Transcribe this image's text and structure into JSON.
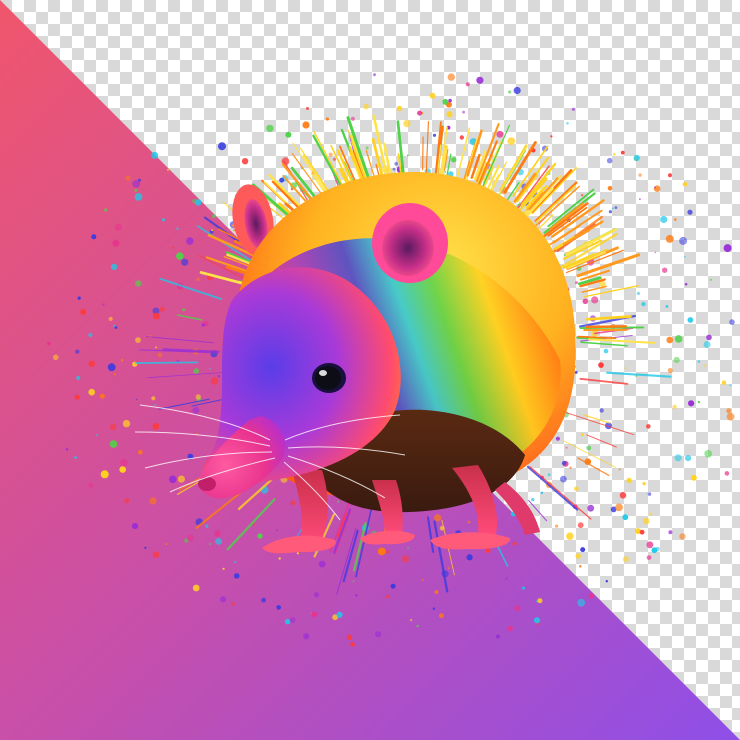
{
  "image": {
    "subject_icon": "rainbow-paint-splash-rodent-icon",
    "background": {
      "gradient_colors": [
        "#f0566c",
        "#c94fa8",
        "#8e4fe8"
      ],
      "transparency_checker_colors": [
        "#ffffff",
        "#d9d9d9"
      ]
    },
    "palette": {
      "body_yellow": "#ffd21f",
      "body_orange": "#ff7a12",
      "body_green": "#4fd24a",
      "body_cyan": "#1fc9e8",
      "body_blue": "#3b3ce0",
      "body_purple": "#9a2fd6",
      "body_magenta": "#e8338f",
      "belly_dark": "#3a1a10",
      "eye": "#0d0d16"
    }
  }
}
